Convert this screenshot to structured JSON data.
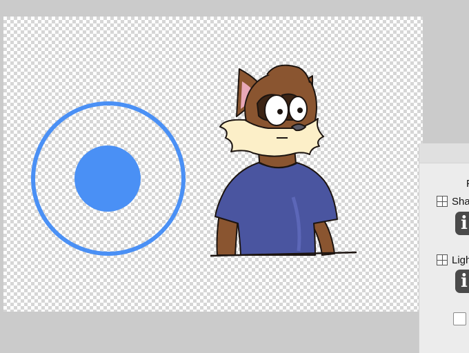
{
  "canvas": {
    "background": "transparency-checkerboard",
    "accent_color": "#4a90f5"
  },
  "artwork": {
    "shape": "radio-target-icon",
    "character": "fox-character-illustration",
    "shirt_color": "#4a55a0",
    "fur_color": "#8a5530"
  },
  "panel": {
    "title": "F",
    "layers": [
      {
        "label": "Sha",
        "icon": "layer-grid-icon",
        "info_label": "i"
      },
      {
        "label": "Ligh",
        "icon": "layer-grid-icon",
        "info_label": "i"
      }
    ],
    "checkbox_checked": false
  }
}
